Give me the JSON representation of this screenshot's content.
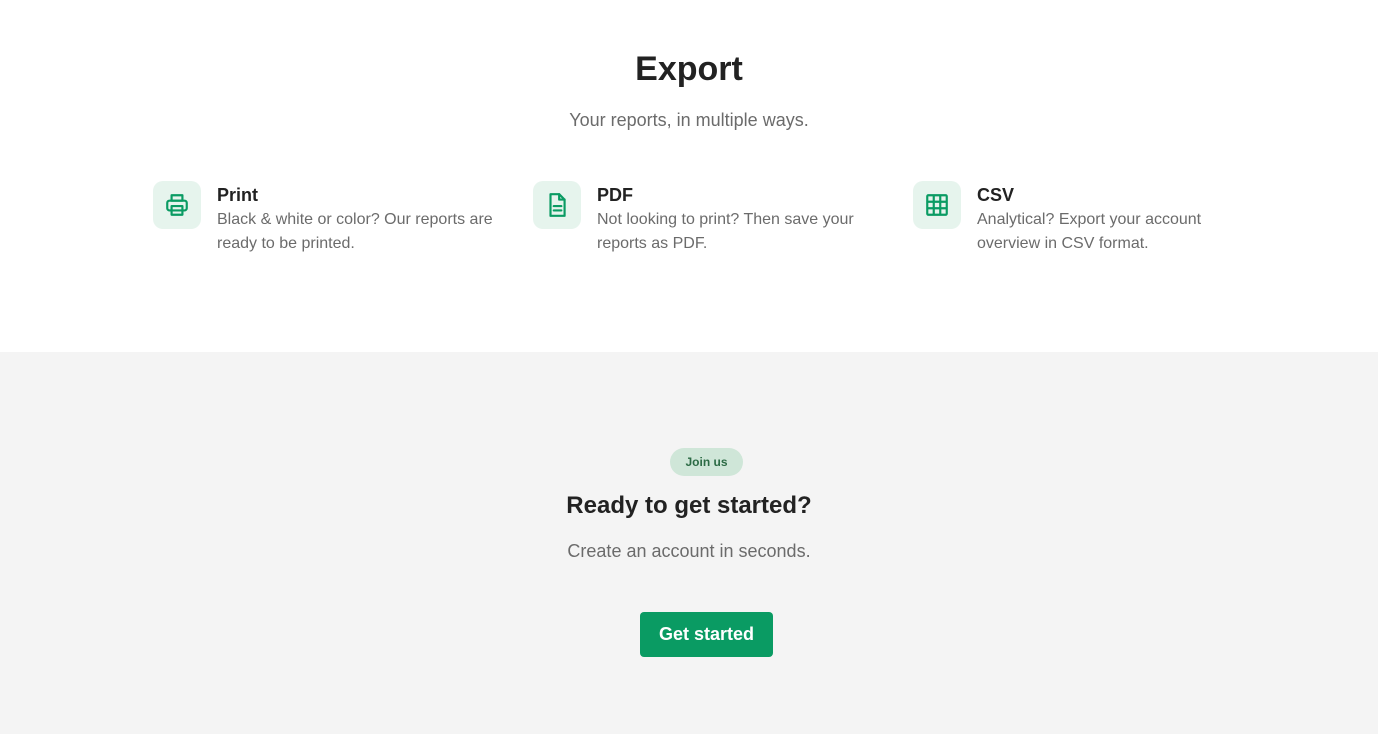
{
  "export": {
    "title": "Export",
    "subtitle": "Your reports, in multiple ways.",
    "features": [
      {
        "icon": "printer-icon",
        "title": "Print",
        "description": "Black & white or color? Our reports are ready to be printed."
      },
      {
        "icon": "document-icon",
        "title": "PDF",
        "description": "Not looking to print? Then save your reports as PDF."
      },
      {
        "icon": "table-grid-icon",
        "title": "CSV",
        "description": "Analytical? Export your account overview in CSV format."
      }
    ]
  },
  "cta": {
    "badge": "Join us",
    "title": "Ready to get started?",
    "subtitle": "Create an account in seconds.",
    "button_label": "Get started"
  },
  "colors": {
    "accent": "#0a9b63",
    "icon_background": "#e6f4ed",
    "badge_background": "#cfe6d8",
    "badge_text": "#2c6b45",
    "cta_background": "#f4f4f4",
    "muted_text": "#6b6b6b",
    "heading_text": "#222222"
  }
}
